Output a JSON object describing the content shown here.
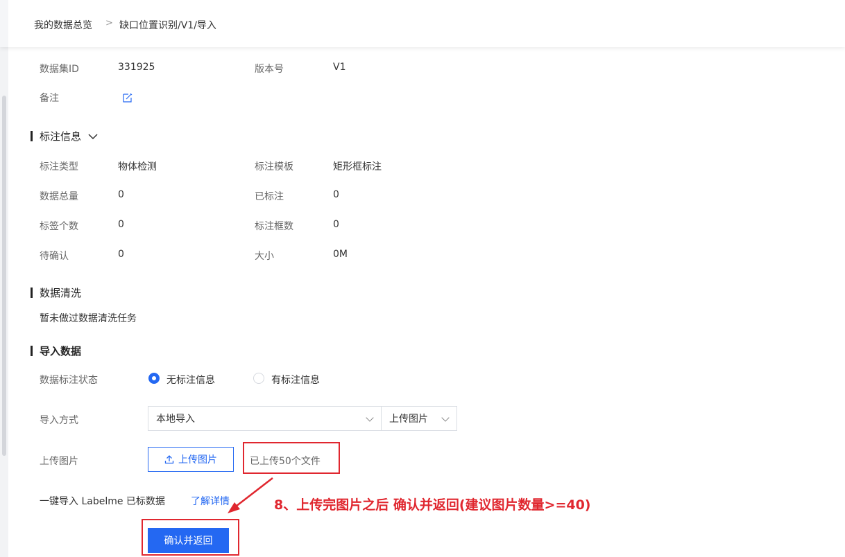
{
  "breadcrumb": {
    "root": "我的数据总览",
    "separator": ">",
    "current": "缺口位置识别/V1/导入"
  },
  "dataset": {
    "id_label": "数据集ID",
    "id_value": "331925",
    "version_label": "版本号",
    "version_value": "V1",
    "note_label": "备注",
    "edit_icon": "edit-icon"
  },
  "annotation_info": {
    "title": "标注信息",
    "rows": [
      {
        "label1": "标注类型",
        "value1": "物体检测",
        "label2": "标注模板",
        "value2": "矩形框标注"
      },
      {
        "label1": "数据总量",
        "value1": "0",
        "label2": "已标注",
        "value2": "0"
      },
      {
        "label1": "标签个数",
        "value1": "0",
        "label2": "标注框数",
        "value2": "0"
      },
      {
        "label1": "待确认",
        "value1": "0",
        "label2": "大小",
        "value2": "0M"
      }
    ]
  },
  "data_cleaning": {
    "title": "数据清洗",
    "text": "暂未做过数据清洗任务"
  },
  "import_data": {
    "title": "导入数据",
    "status_label": "数据标注状态",
    "options": [
      "无标注信息",
      "有标注信息"
    ],
    "selected_option": "无标注信息",
    "method_label": "导入方式",
    "method_value": "本地导入",
    "type_value": "上传图片",
    "upload_label": "上传图片",
    "upload_button": "上传图片",
    "uploaded_text": "已上传50个文件",
    "labelme_text": "一键导入 Labelme 已标数据",
    "learn_more": "了解详情",
    "confirm_button": "确认并返回"
  },
  "overlay": {
    "instruction": "8、上传完图片之后 确认并返回(建议图片数量>=40)",
    "color": "#e0272f"
  },
  "colors": {
    "accent": "#2468f2",
    "annotation_red": "#e0272f"
  }
}
